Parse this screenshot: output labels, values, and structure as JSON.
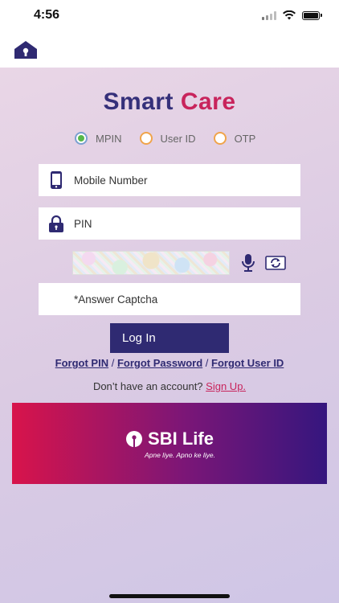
{
  "status_bar": {
    "time": "4:56"
  },
  "app": {
    "title_part1": "Smart",
    "title_part2": "Care"
  },
  "login_type": {
    "options": [
      {
        "label": "MPIN",
        "selected": true
      },
      {
        "label": "User ID",
        "selected": false
      },
      {
        "label": "OTP",
        "selected": false
      }
    ]
  },
  "fields": {
    "mobile": {
      "placeholder": "Mobile Number",
      "value": ""
    },
    "pin": {
      "placeholder": "PIN",
      "value": ""
    },
    "captcha_answer": {
      "placeholder": "*Answer Captcha",
      "value": ""
    }
  },
  "buttons": {
    "login": "Log In"
  },
  "links": {
    "forgot_pin": "Forgot PIN",
    "separator": "/",
    "forgot_password": "Forgot Password",
    "forgot_user_id": "Forgot User ID",
    "no_account": "Don’t have an account?",
    "sign_up": "Sign Up."
  },
  "banner": {
    "brand": "SBI Life",
    "tagline": "Apne liye. Apno ke liye."
  },
  "colors": {
    "primary": "#2f2a72",
    "accent": "#c8245c",
    "radio_selected": "#56b84a",
    "radio_ring": "#f0a44b",
    "banner_start": "#d8144b",
    "banner_end": "#35167e"
  },
  "icons": [
    "home-icon",
    "phone-icon",
    "lock-icon",
    "microphone-icon",
    "refresh-icon",
    "sbi-keyhole-icon"
  ]
}
